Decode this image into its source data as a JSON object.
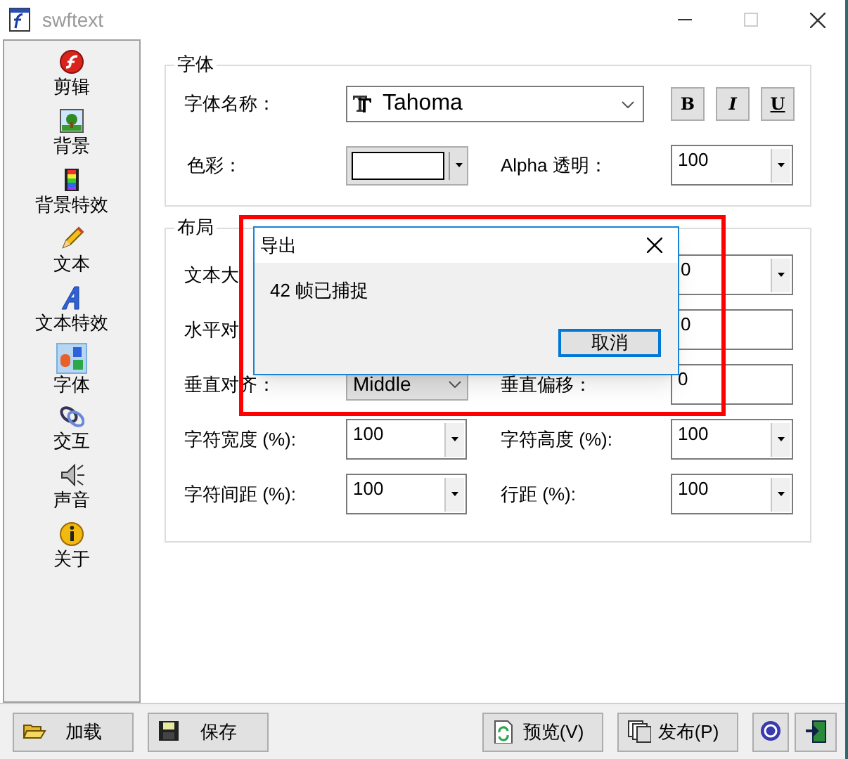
{
  "window": {
    "title": "swftext"
  },
  "sidebar": {
    "items": [
      {
        "label": "剪辑",
        "selected": false
      },
      {
        "label": "背景",
        "selected": false
      },
      {
        "label": "背景特效",
        "selected": false
      },
      {
        "label": "文本",
        "selected": false
      },
      {
        "label": "文本特效",
        "selected": false
      },
      {
        "label": "字体",
        "selected": true
      },
      {
        "label": "交互",
        "selected": false
      },
      {
        "label": "声音",
        "selected": false
      },
      {
        "label": "关于",
        "selected": false
      }
    ]
  },
  "font_group": {
    "title": "字体",
    "font_name_label": "字体名称：",
    "font_name": "Tahoma",
    "style_buttons": [
      {
        "label": "B",
        "kind": "bold"
      },
      {
        "label": "I",
        "kind": "italic"
      },
      {
        "label": "U",
        "kind": "underline"
      }
    ],
    "color_label": "色彩：",
    "alpha_label": "Alpha 透明：",
    "alpha": "100"
  },
  "layout_group": {
    "title": "布局",
    "rows": [
      {
        "left_label": "文本大",
        "right_field": {
          "kind": "spin",
          "value": "0"
        }
      },
      {
        "left_label": "水平对",
        "right_field": {
          "kind": "text",
          "value": "0"
        }
      },
      {
        "left_label": "垂直对齐：",
        "left_field": {
          "kind": "select",
          "value": "Middle"
        },
        "right_label": "垂直偏移：",
        "right_field": {
          "kind": "text",
          "value": "0"
        }
      },
      {
        "left_label": "字符宽度 (%):",
        "left_field": {
          "kind": "spin",
          "value": "100"
        },
        "right_label": "字符高度 (%):",
        "right_field": {
          "kind": "spin",
          "value": "100"
        }
      },
      {
        "left_label": "字符间距 (%):",
        "left_field": {
          "kind": "spin",
          "value": "100"
        },
        "right_label": "行距 (%):",
        "right_field": {
          "kind": "spin",
          "value": "100"
        }
      }
    ]
  },
  "bottom_buttons": [
    {
      "kind": "labeled",
      "label": "加载"
    },
    {
      "kind": "labeled",
      "label": "保存"
    },
    {
      "kind": "labeled",
      "label": "预览(V)"
    },
    {
      "kind": "labeled",
      "label": "发布(P)"
    },
    {
      "kind": "icon"
    },
    {
      "kind": "icon"
    }
  ],
  "dialog": {
    "title": "导出",
    "message": "42 帧已捕捉",
    "button": "取消"
  }
}
